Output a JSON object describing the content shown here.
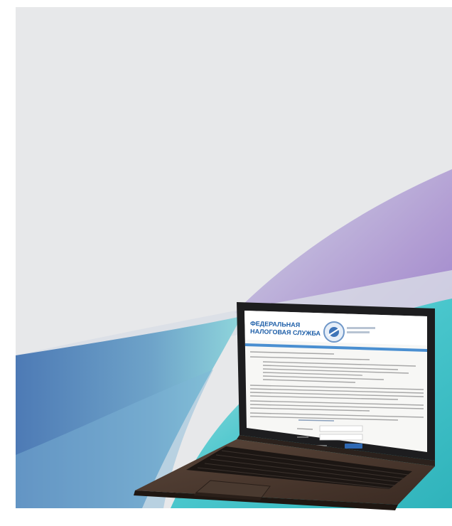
{
  "site": {
    "title_line1": "ФЕДЕРАЛЬНАЯ",
    "title_line2": "НАЛОГОВАЯ СЛУЖБА"
  },
  "colors": {
    "page_bg": "#ffffff",
    "panel_bg": "#e7e8ea",
    "teal": "#3fc2c8",
    "violet": "#9b7fc8",
    "blue": "#5a86bd",
    "laptop_body": "#3a2a22",
    "fns_blue": "#1d5ea8"
  },
  "icons": {
    "emblem": "fns-emblem-icon"
  }
}
